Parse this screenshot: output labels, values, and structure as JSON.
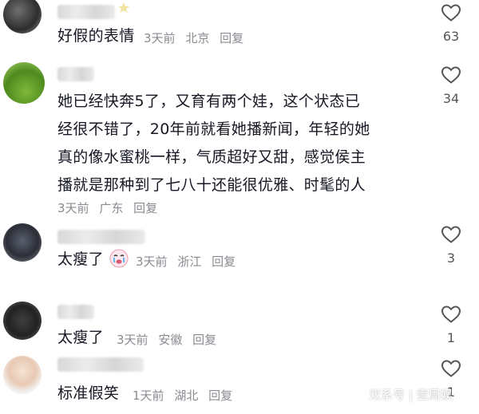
{
  "comments": [
    {
      "text": "好假的表情",
      "time": "3天前",
      "location": "北京",
      "reply_label": "回复",
      "likes": "63"
    },
    {
      "lines": [
        "她已经快奔5了，又育有两个娃，这个状态已",
        "经很不错了，20年前就看她播新闻，年轻的她",
        "真的像水蜜桃一样，气质超好又甜，感觉侯主",
        "播就是那种到了七八十还能很优雅、时髦的人"
      ],
      "time": "3天前",
      "location": "广东",
      "reply_label": "回复",
      "likes": "34"
    },
    {
      "text": "太瘦了",
      "emoji": "crying-face-emoji",
      "time": "3天前",
      "location": "浙江",
      "reply_label": "回复",
      "likes": "3"
    },
    {
      "text": "太瘦了",
      "time": "3天前",
      "location": "安徽",
      "reply_label": "回复",
      "likes": "1"
    },
    {
      "text": "标准假笑",
      "time": "1天前",
      "location": "湖北",
      "reply_label": "回复",
      "likes": "1"
    }
  ],
  "watermark": "双系号 | 壹周娱",
  "icons": {
    "like": "heart-outline-icon"
  },
  "colors": {
    "text": "#161823",
    "meta": "#8a8b91",
    "heart_stroke": "#555555"
  }
}
